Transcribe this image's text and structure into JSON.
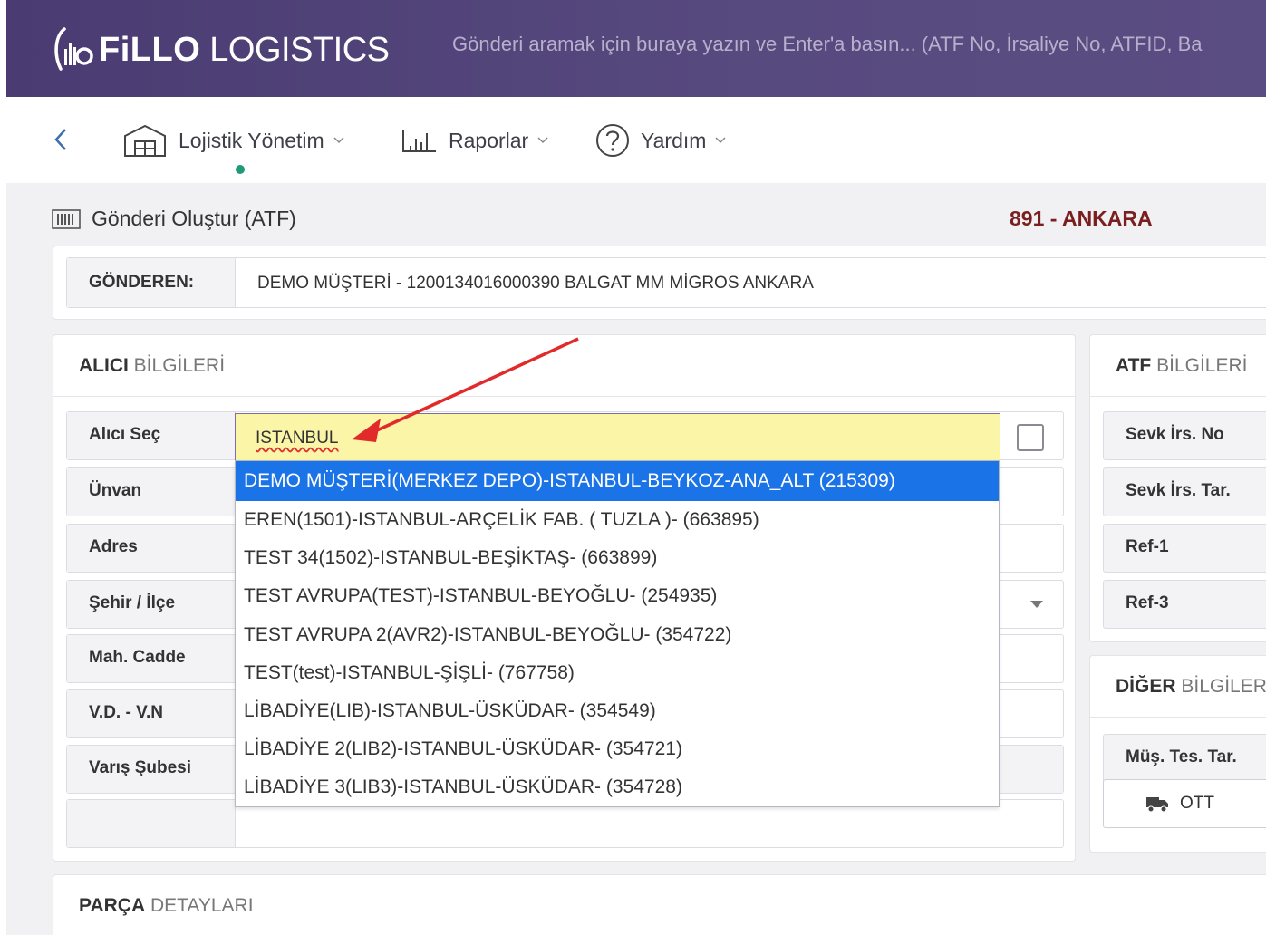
{
  "header": {
    "brand_bold": "FiLLO",
    "brand_light": "LOGISTICS",
    "search_placeholder": "Gönderi aramak için buraya yazın ve Enter'a basın... (ATF No, İrsaliye No, ATFID, Ba"
  },
  "nav": {
    "items": [
      {
        "label": "Lojistik Yönetim",
        "icon": "warehouse-icon"
      },
      {
        "label": "Raporlar",
        "icon": "bar-chart-icon"
      },
      {
        "label": "Yardım",
        "icon": "help-circle-icon"
      }
    ]
  },
  "page": {
    "title": "Gönderi Oluştur (ATF)",
    "branch": "891 - ANKARA"
  },
  "sender": {
    "label": "GÖNDEREN:",
    "value": "DEMO MÜŞTERİ - 1200134016000390 BALGAT MM MİGROS ANKARA"
  },
  "alici": {
    "header_bold": "ALICI",
    "header_light": "BİLGİLERİ",
    "rows": [
      {
        "label": "Alıcı Seç"
      },
      {
        "label": "Ünvan"
      },
      {
        "label": "Adres"
      },
      {
        "label": "Şehir / İlçe"
      },
      {
        "label": "Mah. Cadde"
      },
      {
        "label": "V.D. - V.N"
      },
      {
        "label": "Varış Şubesi"
      }
    ],
    "search_value": "ISTANBUL",
    "dropdown": [
      "DEMO MÜŞTERİ(MERKEZ DEPO)-ISTANBUL-BEYKOZ-ANA_ALT (215309)",
      "EREN(1501)-ISTANBUL-ARÇELİK FAB. ( TUZLA )- (663895)",
      "TEST 34(1502)-ISTANBUL-BEŞİKTAŞ- (663899)",
      "TEST AVRUPA(TEST)-ISTANBUL-BEYOĞLU- (254935)",
      "TEST AVRUPA 2(AVR2)-ISTANBUL-BEYOĞLU- (354722)",
      "TEST(test)-ISTANBUL-ŞİŞLİ- (767758)",
      "LİBADİYE(LIB)-ISTANBUL-ÜSKÜDAR- (354549)",
      "LİBADİYE 2(LIB2)-ISTANBUL-ÜSKÜDAR- (354721)",
      "LİBADİYE 3(LIB3)-ISTANBUL-ÜSKÜDAR- (354728)"
    ]
  },
  "atf": {
    "header_bold": "ATF",
    "header_light": "BİLGİLERİ",
    "rows": [
      {
        "label": "Sevk İrs. No"
      },
      {
        "label": "Sevk İrs. Tar."
      },
      {
        "label": "Ref-1"
      },
      {
        "label": "Ref-3"
      }
    ]
  },
  "diger": {
    "header_bold": "DİĞER",
    "header_light": "BİLGİLERİ",
    "rows": [
      {
        "label": "Müş. Tes. Tar."
      }
    ],
    "ott_label": "OTT"
  },
  "parca": {
    "header_bold": "PARÇA",
    "header_light": "DETAYLARI"
  },
  "colors": {
    "header_bg": "#4a3c72",
    "accent_green": "#1e9a78",
    "branch_red": "#7a1f1f",
    "selection_blue": "#1b73e8",
    "input_highlight": "#fbf5a8",
    "arrow_red": "#e32a2a"
  }
}
